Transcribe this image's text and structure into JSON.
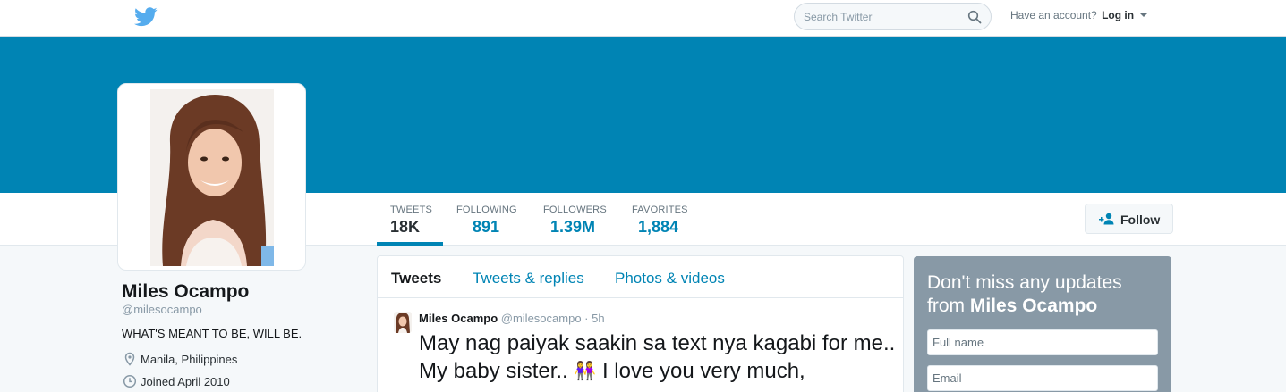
{
  "colors": {
    "banner": "#0084b4",
    "link": "#0084b4"
  },
  "topbar": {
    "logo_icon": "twitter-bird-icon",
    "search_placeholder": "Search Twitter",
    "have_account": "Have an account?",
    "login_label": "Log in"
  },
  "profile": {
    "name": "Miles Ocampo",
    "handle": "@milesocampo",
    "bio": "WHAT'S MEANT TO BE, WILL BE.",
    "location": "Manila, Philippines",
    "joined": "Joined April 2010"
  },
  "stats": [
    {
      "label": "TWEETS",
      "value": "18K"
    },
    {
      "label": "FOLLOWING",
      "value": "891"
    },
    {
      "label": "FOLLOWERS",
      "value": "1.39M"
    },
    {
      "label": "FAVORITES",
      "value": "1,884"
    }
  ],
  "follow_label": "Follow",
  "tabs": [
    "Tweets",
    "Tweets & replies",
    "Photos & videos"
  ],
  "tweet": {
    "name": "Miles Ocampo",
    "handle": "@milesocampo",
    "dot": "·",
    "time": "5h",
    "text_part1": "May nag paiyak saakin sa text nya kagabi for me.. My baby sister.. ",
    "emoji": "👭",
    "text_part2": " I love you very much,"
  },
  "signup": {
    "heading_line1": "Don't miss any updates",
    "heading_from": "from ",
    "heading_name": "Miles Ocampo",
    "fullname_placeholder": "Full name",
    "email_placeholder": "Email"
  }
}
